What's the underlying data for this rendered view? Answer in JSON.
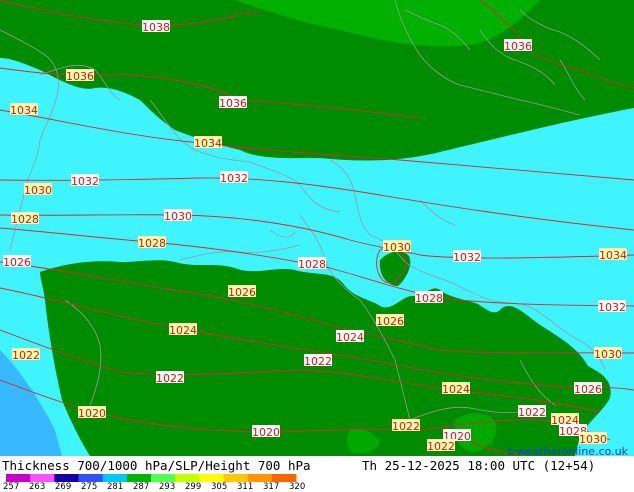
{
  "footer": {
    "title": "Thickness 700/1000 hPa/SLP/Height 700 hPa",
    "valid_time": "Th 25-12-2025 18:00 UTC (12+54)",
    "credit": "©weatheronline.co.uk",
    "scale_ticks": [
      "257",
      "263",
      "269",
      "275",
      "281",
      "287",
      "293",
      "299",
      "305",
      "311",
      "317",
      "320"
    ],
    "scale_colors": [
      "#c800c8",
      "#ff50ff",
      "#1400a0",
      "#3250ff",
      "#00c8ff",
      "#00b400",
      "#50ff50",
      "#c8ff00",
      "#ffff00",
      "#ffc800",
      "#ff9600",
      "#ff6400"
    ]
  },
  "isobars": [
    {
      "text": "1038"
    },
    {
      "text": "1036"
    },
    {
      "text": "1036"
    },
    {
      "text": "1034"
    },
    {
      "text": "1036"
    },
    {
      "text": "1034"
    },
    {
      "text": "1032"
    },
    {
      "text": "1030"
    },
    {
      "text": "1032"
    },
    {
      "text": "1028"
    },
    {
      "text": "1030"
    },
    {
      "text": "1028"
    },
    {
      "text": "1026"
    },
    {
      "text": "1030"
    },
    {
      "text": "1032"
    },
    {
      "text": "1034"
    },
    {
      "text": "1028"
    },
    {
      "text": "1026"
    },
    {
      "text": "1028"
    },
    {
      "text": "1026"
    },
    {
      "text": "1032"
    },
    {
      "text": "1024"
    },
    {
      "text": "1024"
    },
    {
      "text": "1022"
    },
    {
      "text": "1022"
    },
    {
      "text": "1030"
    },
    {
      "text": "1022"
    },
    {
      "text": "1024"
    },
    {
      "text": "1026"
    },
    {
      "text": "1020"
    },
    {
      "text": "1022"
    },
    {
      "text": "1024"
    },
    {
      "text": "1020"
    },
    {
      "text": "1022"
    },
    {
      "text": "1020"
    },
    {
      "text": "1022"
    },
    {
      "text": "1028"
    },
    {
      "text": "1030"
    }
  ]
}
